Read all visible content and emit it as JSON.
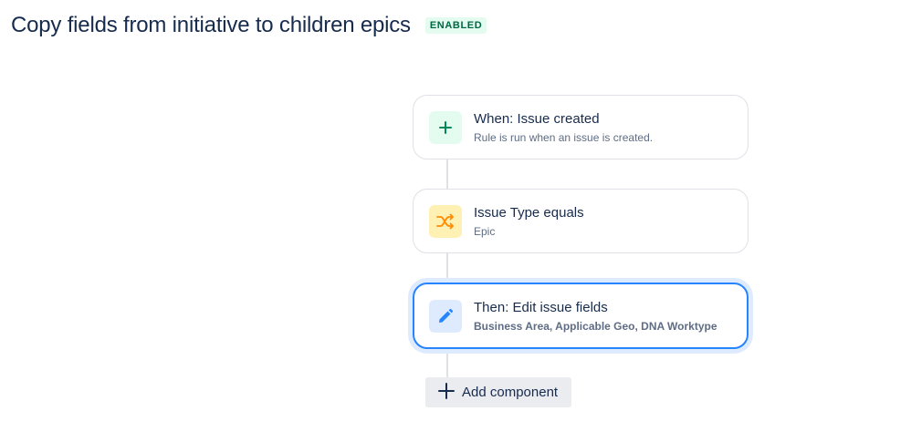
{
  "rule": {
    "title": "Copy fields from initiative to children epics",
    "status": "ENABLED"
  },
  "components": [
    {
      "type": "trigger",
      "icon": "plus-icon",
      "title": "When: Issue created",
      "subtitle": "Rule is run when an issue is created."
    },
    {
      "type": "condition",
      "icon": "shuffle-icon",
      "title": "Issue Type equals",
      "subtitle": "Epic"
    },
    {
      "type": "action",
      "icon": "pencil-icon",
      "title": "Then: Edit issue fields",
      "subtitle": "Business Area, Applicable Geo, DNA Worktype",
      "selected": true
    }
  ],
  "add_component": {
    "label": "Add component",
    "icon": "plus-icon"
  },
  "colors": {
    "badge_bg": "#e3fcef",
    "badge_text": "#006644",
    "trigger_accent": "#00875a",
    "condition_accent": "#ff8b00",
    "action_accent": "#2684ff",
    "selected_ring": "#deebff"
  }
}
